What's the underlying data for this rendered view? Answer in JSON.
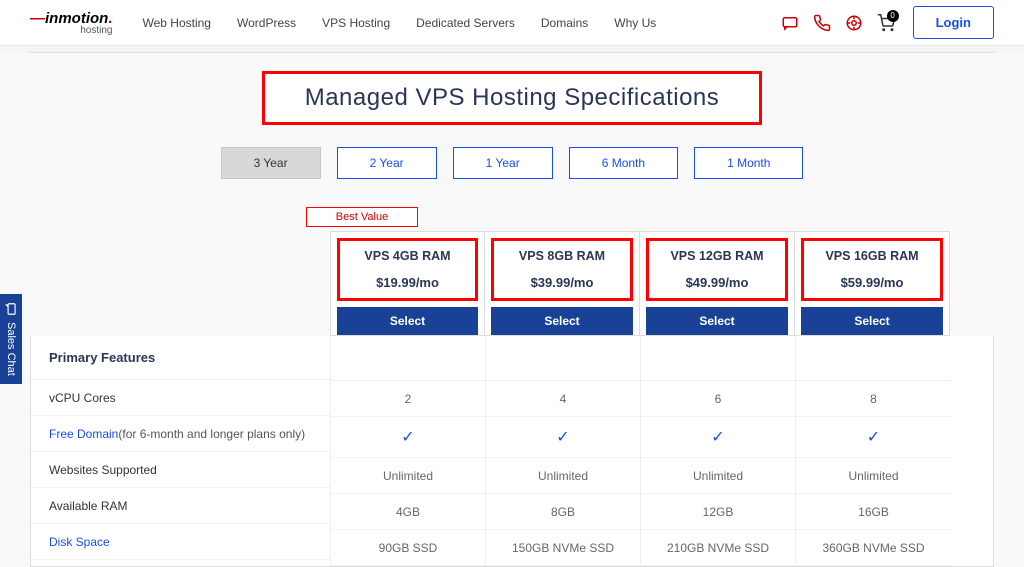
{
  "header": {
    "logo_main": "inmotion",
    "logo_sub": "hosting",
    "nav": [
      "Web Hosting",
      "WordPress",
      "VPS Hosting",
      "Dedicated Servers",
      "Domains",
      "Why Us"
    ],
    "cart_count": "0",
    "login": "Login"
  },
  "title": "Managed VPS Hosting Specifications",
  "tabs": [
    "3 Year",
    "2 Year",
    "1 Year",
    "6 Month",
    "1 Month"
  ],
  "active_tab": 0,
  "best_value": "Best Value",
  "plans": [
    {
      "name": "VPS 4GB RAM",
      "price": "$19.99/mo",
      "select": "Select"
    },
    {
      "name": "VPS 8GB RAM",
      "price": "$39.99/mo",
      "select": "Select"
    },
    {
      "name": "VPS 12GB RAM",
      "price": "$49.99/mo",
      "select": "Select"
    },
    {
      "name": "VPS 16GB RAM",
      "price": "$59.99/mo",
      "select": "Select"
    }
  ],
  "spec_header": "Primary Features",
  "spec_rows": [
    {
      "label": "vCPU Cores",
      "link": false,
      "extra": ""
    },
    {
      "label": "Free Domain",
      "link": true,
      "extra": " (for 6-month and longer plans only)"
    },
    {
      "label": "Websites Supported",
      "link": false,
      "extra": ""
    },
    {
      "label": "Available RAM",
      "link": false,
      "extra": ""
    },
    {
      "label": "Disk Space",
      "link": true,
      "extra": ""
    }
  ],
  "spec_values": [
    [
      "2",
      "4",
      "6",
      "8"
    ],
    [
      "check",
      "check",
      "check",
      "check"
    ],
    [
      "Unlimited",
      "Unlimited",
      "Unlimited",
      "Unlimited"
    ],
    [
      "4GB",
      "8GB",
      "12GB",
      "16GB"
    ],
    [
      "90GB SSD",
      "150GB NVMe SSD",
      "210GB NVMe SSD",
      "360GB NVMe SSD"
    ]
  ],
  "sales_chat": "Sales Chat"
}
